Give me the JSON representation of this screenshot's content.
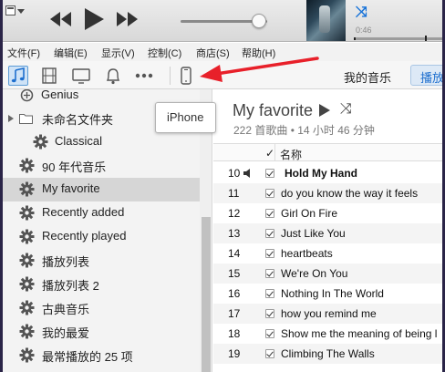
{
  "player": {
    "elapsed_time": "0:46",
    "volume_level": 0.9
  },
  "menu": [
    {
      "id": "file",
      "label": "文件(F)"
    },
    {
      "id": "edit",
      "label": "编辑(E)"
    },
    {
      "id": "view",
      "label": "显示(V)"
    },
    {
      "id": "control",
      "label": "控制(C)"
    },
    {
      "id": "store",
      "label": "商店(S)"
    },
    {
      "id": "help",
      "label": "帮助(H)"
    }
  ],
  "toolbar": {
    "my_music": "我的音乐",
    "playlist_button": "播放",
    "device_tooltip": "iPhone",
    "icons": [
      "music-icon",
      "movies-icon",
      "tv-icon",
      "podcasts-icon",
      "more-icon",
      "iphone-icon"
    ]
  },
  "sidebar": {
    "items": [
      {
        "label": "Genius",
        "icon": "genius-icon",
        "selected": false
      },
      {
        "label": "未命名文件夹",
        "icon": "folder-icon",
        "selected": false
      },
      {
        "label": "Classical",
        "icon": "gear-icon",
        "selected": false
      },
      {
        "label": "90 年代音乐",
        "icon": "gear-icon",
        "selected": false
      },
      {
        "label": "My favorite",
        "icon": "gear-icon",
        "selected": true
      },
      {
        "label": "Recently added",
        "icon": "gear-icon",
        "selected": false
      },
      {
        "label": "Recently played",
        "icon": "gear-icon",
        "selected": false
      },
      {
        "label": "播放列表",
        "icon": "gear-icon",
        "selected": false
      },
      {
        "label": "播放列表 2",
        "icon": "gear-icon",
        "selected": false
      },
      {
        "label": "古典音乐",
        "icon": "gear-icon",
        "selected": false
      },
      {
        "label": "我的最爱",
        "icon": "gear-icon",
        "selected": false
      },
      {
        "label": "最常播放的 25 项",
        "icon": "gear-icon",
        "selected": false
      }
    ]
  },
  "playlist": {
    "title": "My favorite",
    "meta": "222 首歌曲 • 14 小时 46 分钟",
    "columns": {
      "check": "✓",
      "name": "名称"
    },
    "tracks": [
      {
        "num": "10",
        "name": "Hold My Hand",
        "playing": true
      },
      {
        "num": "11",
        "name": "do you know the way it feels",
        "playing": false
      },
      {
        "num": "12",
        "name": "Girl On Fire",
        "playing": false
      },
      {
        "num": "13",
        "name": "Just Like You",
        "playing": false
      },
      {
        "num": "14",
        "name": "heartbeats",
        "playing": false
      },
      {
        "num": "15",
        "name": "We're On You",
        "playing": false
      },
      {
        "num": "16",
        "name": "Nothing In The World",
        "playing": false
      },
      {
        "num": "17",
        "name": "how you remind me",
        "playing": false
      },
      {
        "num": "18",
        "name": "Show me the meaning of being l",
        "playing": false
      },
      {
        "num": "19",
        "name": "Climbing The Walls",
        "playing": false
      }
    ]
  }
}
